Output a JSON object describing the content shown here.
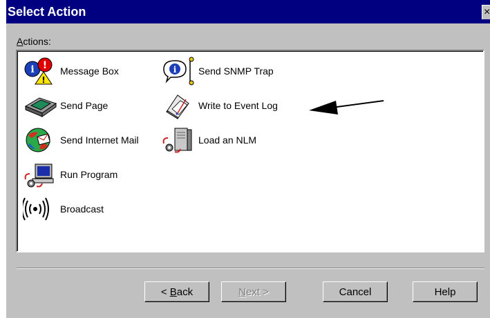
{
  "window": {
    "title": "Select Action",
    "close_glyph": "×"
  },
  "actions_label": {
    "accel": "A",
    "rest": "ctions:"
  },
  "actions": [
    {
      "label": "Message Box",
      "icon": "message-box-icon"
    },
    {
      "label": "Send Page",
      "icon": "pager-icon"
    },
    {
      "label": "Send Internet Mail",
      "icon": "internet-mail-icon"
    },
    {
      "label": "Run Program",
      "icon": "run-program-icon"
    },
    {
      "label": "Broadcast",
      "icon": "broadcast-icon"
    },
    {
      "label": "Send SNMP Trap",
      "icon": "snmp-trap-icon"
    },
    {
      "label": "Write to Event Log",
      "icon": "event-log-icon"
    },
    {
      "label": "Load an NLM",
      "icon": "load-nlm-icon"
    }
  ],
  "buttons": {
    "back": {
      "prefix": "< ",
      "accel": "B",
      "rest": "ack"
    },
    "next": {
      "accel": "N",
      "rest": "ext",
      "suffix": " >"
    },
    "cancel": "Cancel",
    "help": "Help"
  }
}
